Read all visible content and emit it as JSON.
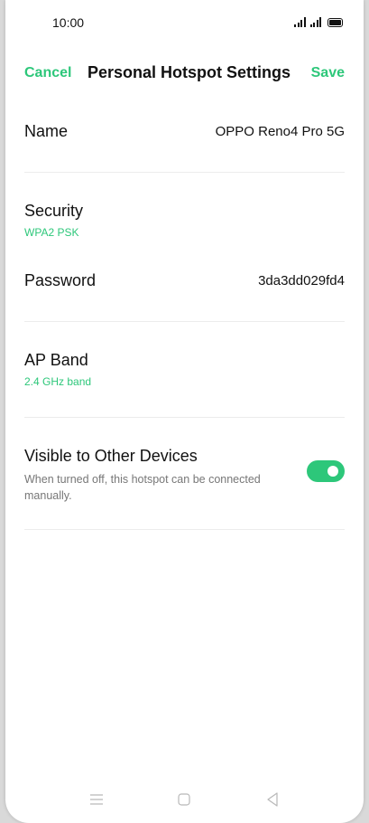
{
  "status_bar": {
    "time": "10:00"
  },
  "header": {
    "cancel_label": "Cancel",
    "title": "Personal Hotspot Settings",
    "save_label": "Save"
  },
  "settings": {
    "name": {
      "label": "Name",
      "value": "OPPO Reno4 Pro 5G"
    },
    "security": {
      "label": "Security",
      "value": "WPA2 PSK"
    },
    "password": {
      "label": "Password",
      "value": "3da3dd029fd4"
    },
    "ap_band": {
      "label": "AP Band",
      "value": "2.4 GHz band"
    },
    "visible": {
      "label": "Visible to Other Devices",
      "description": "When turned off, this hotspot can be connected manually.",
      "enabled": true
    }
  },
  "colors": {
    "accent": "#2dc77a",
    "text": "#111111",
    "secondary_text": "#777777",
    "divider": "#ececec"
  },
  "icons": {
    "nav_menu": "menu-icon",
    "nav_home": "home-icon",
    "nav_back": "back-icon"
  }
}
